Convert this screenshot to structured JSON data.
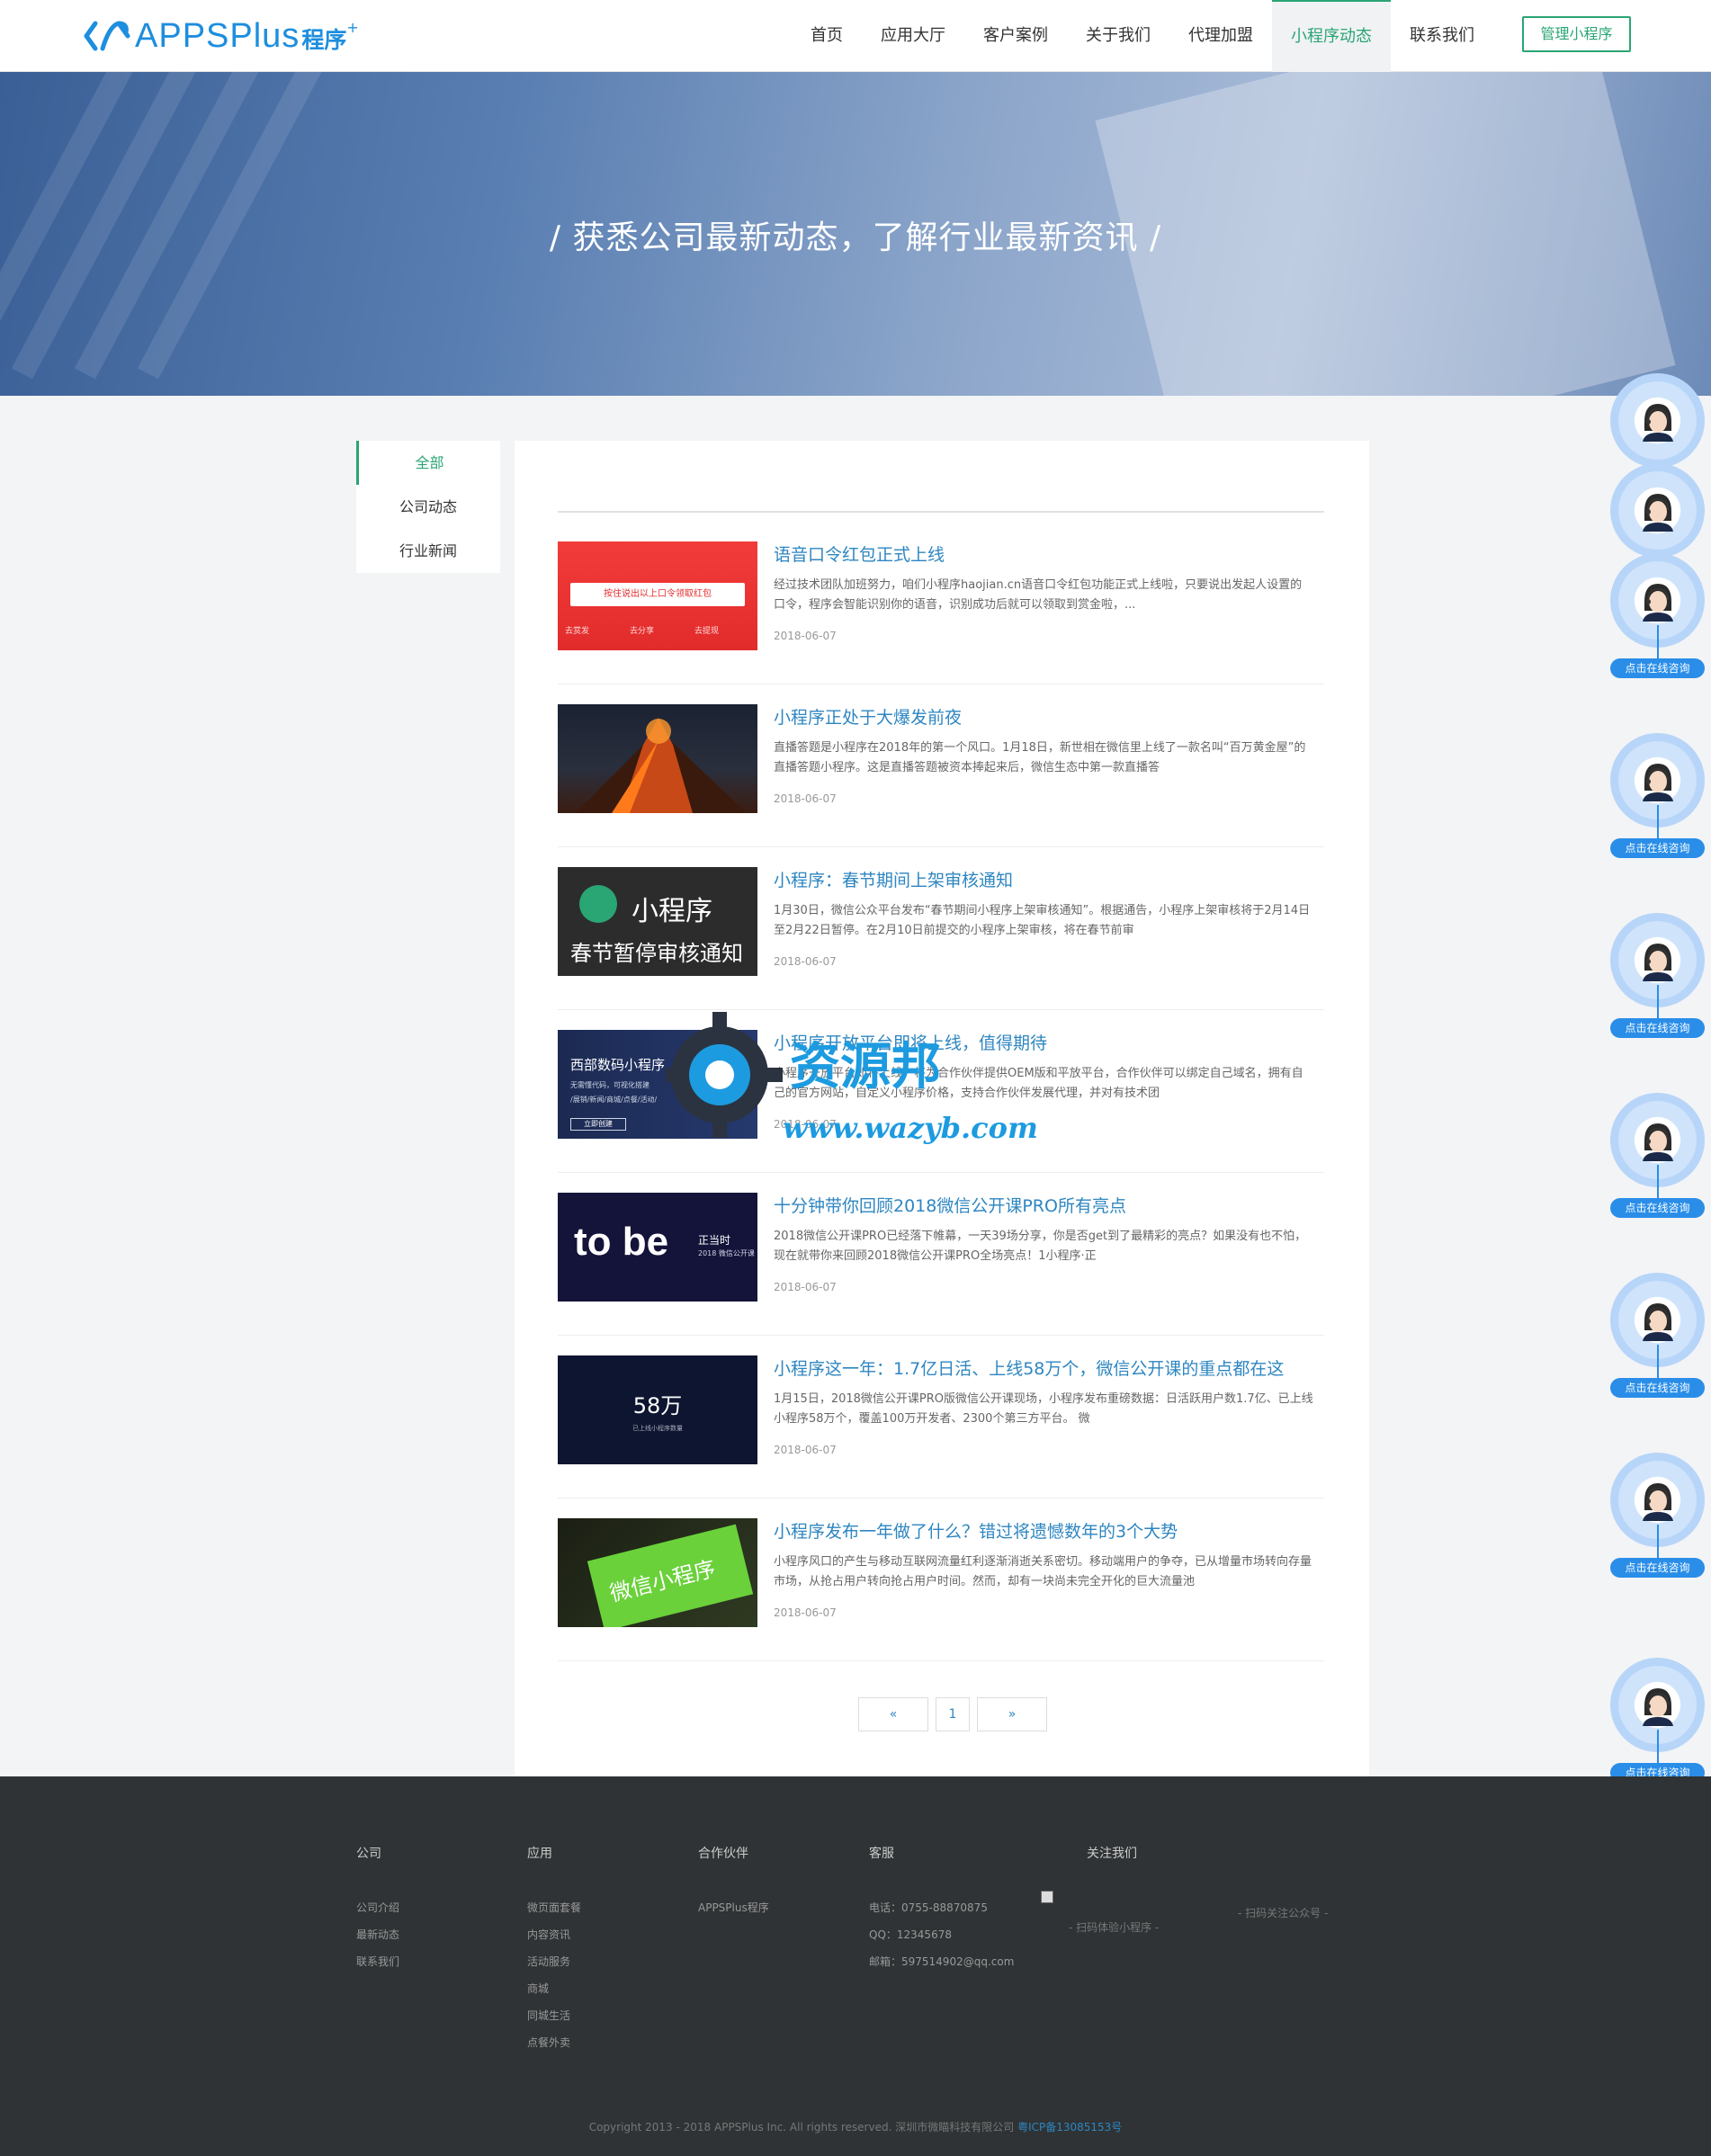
{
  "header": {
    "logo_text": "APPSPlus",
    "logo_sub": "程序",
    "nav": [
      "首页",
      "应用大厅",
      "客户案例",
      "关于我们",
      "代理加盟",
      "小程序动态",
      "联系我们"
    ],
    "active_nav": 5,
    "manage_label": "管理小程序"
  },
  "banner": {
    "title": "/ 获悉公司最新动态，了解行业最新资讯 /"
  },
  "sidebar": {
    "items": [
      "全部",
      "公司动态",
      "行业新闻"
    ],
    "active": 0
  },
  "articles": [
    {
      "title": "语音口令红包正式上线",
      "desc": "经过技术团队加班努力，咱们小程序haojian.cn语音口令红包功能正式上线啦，只要说出发起人设置的口令，程序会智能识别你的语音，识别成功后就可以领取到赏金啦，...",
      "date": "2018-06-07",
      "thumb": {
        "kind": "redpacket",
        "btn": "按住说出以上口令领取红包",
        "links": [
          "去赏发",
          "去分享",
          "去提现"
        ]
      }
    },
    {
      "title": "小程序正处于大爆发前夜",
      "desc": "直播答题是小程序在2018年的第一个风口。1月18日，新世相在微信里上线了一款名叫“百万黄金屋”的直播答题小程序。这是直播答题被资本捧起来后，微信生态中第一款直播答",
      "date": "2018-06-07",
      "thumb": {
        "kind": "volcano"
      }
    },
    {
      "title": "小程序：春节期间上架审核通知",
      "desc": "1月30日，微信公众平台发布“春节期间小程序上架审核通知”。根据通告，小程序上架审核将于2月14日至2月22日暂停。在2月10日前提交的小程序上架审核，将在春节前审",
      "date": "2018-06-07",
      "thumb": {
        "kind": "notice",
        "line1": "小程序",
        "line2": "春节暂停审核通知"
      }
    },
    {
      "title": "小程序开放平台即将上线，值得期待",
      "desc": "小程序开放平台即将上线，将为合作伙伴提供OEM版和平放平台，合作伙伴可以绑定自己域名，拥有自己的官方网站，自定义小程序价格，支持合作伙伴发展代理，并对有技术团",
      "date": "2018-06-07",
      "thumb": {
        "kind": "digital",
        "line1": "西部数码小程序",
        "line2": "正式",
        "line3": "无需懂代码，可视化搭建",
        "line4": "/展销/新闻/商城/点餐/活动/",
        "btn": "立即创建"
      }
    },
    {
      "title": "十分钟带你回顾2018微信公开课PRO所有亮点",
      "desc": "2018微信公开课PRO已经落下帷幕，一天39场分享，你是否get到了最精彩的亮点？如果没有也不怕，现在就带你来回顾2018微信公开课PRO全场亮点！1小程序·正",
      "date": "2018-06-07",
      "thumb": {
        "kind": "tobe",
        "word": "to be",
        "side1": "正当时",
        "side2": "2018 微信公开课"
      }
    },
    {
      "title": "小程序这一年：1.7亿日活、上线58万个，微信公开课的重点都在这",
      "desc": "1月15日，2018微信公开课PRO版微信公开课现场，小程序发布重磅数据：日活跃用户数1.7亿、已上线小程序58万个，覆盖100万开发者、2300个第三方平台。 微",
      "date": "2018-06-07",
      "thumb": {
        "kind": "stat",
        "number": "58万",
        "caption": "已上线小程序数量"
      }
    },
    {
      "title": "小程序发布一年做了什么？错过将遗憾数年的3个大势",
      "desc": "小程序风口的产生与移动互联网流量红利逐渐消逝关系密切。移动端用户的争夺，已从增量市场转向存量市场，从抢占用户转向抢占用户时间。然而，却有一块尚未完全开化的巨大流量池",
      "date": "2018-06-07",
      "thumb": {
        "kind": "wechat",
        "text": "微信小程序"
      }
    }
  ],
  "pager": {
    "prev": "«",
    "page": "1",
    "next": "»"
  },
  "float": {
    "badge": "点击在线咨询"
  },
  "footer": {
    "cols": [
      {
        "head": "公司",
        "links": [
          "公司介绍",
          "最新动态",
          "联系我们"
        ]
      },
      {
        "head": "应用",
        "links": [
          "微页面套餐",
          "内容资讯",
          "活动服务",
          "商城",
          "同城生活",
          "点餐外卖"
        ]
      },
      {
        "head": "合作伙伴",
        "links": [
          "APPSPlus程序"
        ]
      },
      {
        "head": "客服",
        "links": [
          "电话：0755-88870875",
          "QQ：12345678",
          "邮箱：597514902@qq.com"
        ]
      },
      {
        "head": "关注我们",
        "links": []
      }
    ],
    "qr1": "- 扫码体验小程序 -",
    "qr2": "- 扫码关注公众号 -",
    "copyright": "Copyright 2013 - 2018 APPSPlus Inc. All rights reserved. 深圳市微瞄科技有限公司",
    "icp": "粤ICP备13085153号"
  },
  "watermark": {
    "cn": "资源邦",
    "url": "www.wazyb.com"
  },
  "colors": {
    "accent": "#2aa574",
    "link": "#2e86c1",
    "badge": "#2a8ee8",
    "footer": "#2f3335"
  }
}
